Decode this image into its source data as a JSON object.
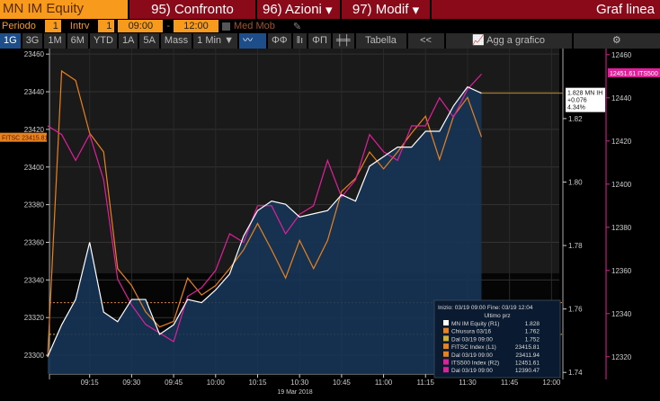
{
  "header": {
    "security": "MN IM Equity",
    "compare": "95) Confronto",
    "actions": "96) Azioni",
    "modify": "97) Modif",
    "chart_type": "Graf linea"
  },
  "params": {
    "period_label": "Periodo",
    "period_value": "1",
    "interval_label": "Intrv",
    "interval_value": "1",
    "start_time": "09:00",
    "dash": "-",
    "end_time": "12:00",
    "moving_avg": "Med Mob"
  },
  "toolbar": {
    "ranges": [
      "1G",
      "3G",
      "1M",
      "6M",
      "YTD",
      "1A",
      "5A",
      "Mass"
    ],
    "active": "1G",
    "interval": "1 Min ▼",
    "table": "Tabella",
    "collapse": "<<",
    "add": "Agg a grafico",
    "settings": "⚙"
  },
  "colors": {
    "mn": "#ffffff",
    "fitsc": "#e8821e",
    "its": "#e0209a",
    "chiusura": "#e8821e",
    "dal": "#d4b030",
    "accent": "#f89b1c"
  },
  "chart_data": {
    "type": "line",
    "date_label": "19 Mar 2018",
    "x_minutes_from_0900": [
      0,
      5,
      10,
      15,
      20,
      25,
      30,
      35,
      40,
      45,
      50,
      55,
      60,
      65,
      70,
      75,
      80,
      85,
      90,
      95,
      100,
      105,
      110,
      115,
      120,
      125,
      130,
      135,
      140,
      145,
      150,
      155
    ],
    "x_ticks": [
      "09:15",
      "09:30",
      "09:45",
      "10:00",
      "10:15",
      "10:30",
      "10:45",
      "11:00",
      "11:15",
      "11:30",
      "11:45",
      "12:00"
    ],
    "left_axis": {
      "ticks": [
        23300,
        23320,
        23340,
        23360,
        23380,
        23400,
        23420,
        23440,
        23460
      ],
      "range": [
        23290,
        23462
      ]
    },
    "mid_axis": {
      "ticks": [
        1.74,
        1.76,
        1.78,
        1.8,
        1.82
      ],
      "range": [
        1.7395,
        1.8415
      ]
    },
    "right_axis": {
      "ticks": [
        12320,
        12340,
        12360,
        12380,
        12400,
        12420,
        12440,
        12460
      ],
      "range": [
        12312,
        12462
      ]
    },
    "series": [
      {
        "name": "MN IM Equity (R1)",
        "axis": "mid",
        "values": [
          1.745,
          1.755,
          1.763,
          1.781,
          1.759,
          1.756,
          1.763,
          1.763,
          1.752,
          1.755,
          1.763,
          1.762,
          1.766,
          1.771,
          1.783,
          1.791,
          1.794,
          1.793,
          1.789,
          1.79,
          1.791,
          1.796,
          1.794,
          1.805,
          1.808,
          1.811,
          1.811,
          1.816,
          1.816,
          1.824,
          1.83,
          1.828
        ]
      },
      {
        "name": "FITSC Index (L1)",
        "axis": "left",
        "values": [
          23299,
          23451,
          23446,
          23418,
          23408,
          23346,
          23337,
          23323,
          23315,
          23318,
          23341,
          23332,
          23337,
          23346,
          23356,
          23370,
          23356,
          23341,
          23361,
          23346,
          23361,
          23387,
          23394,
          23408,
          23399,
          23408,
          23418,
          23427,
          23404,
          23427,
          23437,
          23416
        ]
      },
      {
        "name": "ITS500 Index (R2)",
        "axis": "right",
        "values": [
          12427,
          12423,
          12411,
          12423,
          12402,
          12356,
          12344,
          12335,
          12331,
          12327,
          12348,
          12352,
          12360,
          12377,
          12373,
          12390,
          12390,
          12377,
          12386,
          12390,
          12411,
          12394,
          12402,
          12423,
          12415,
          12411,
          12427,
          12427,
          12440,
          12431,
          12444,
          12451
        ]
      }
    ],
    "ref_lines": [
      {
        "name": "Chiusura 03/16",
        "axis": "mid",
        "value": 1.762
      },
      {
        "name": "Dal 03/19 09:00",
        "axis": "mid",
        "value": 1.752
      }
    ],
    "labels": {
      "fitsc_tag": "FITSC 23415.81",
      "its_tag": "12451.61 ITS500",
      "mn_tag": [
        "1.828 MN IH",
        "+0.076",
        "4.34%"
      ]
    },
    "legend": {
      "header": "Inizio: 03/19 09:00 Fine: 03/19 12:04",
      "sub": "Ultimo prz",
      "rows": [
        [
          "MN IM Equity  (R1)",
          "1.828"
        ],
        [
          "Chiusura 03/16",
          "1.762"
        ],
        [
          "Dal 03/19 09:00",
          "1.752"
        ],
        [
          "FITSC Index  (L1)",
          "23415.81"
        ],
        [
          "Dal 03/19 09:00",
          "23411.94"
        ],
        [
          "ITS500 Index  (R2)",
          "12451.61"
        ],
        [
          "Dal 03/19 09:00",
          "12390.47"
        ]
      ],
      "swatches": [
        "#ffffff",
        "#e8821e",
        "#d4b030",
        "#e8821e",
        "#e8821e",
        "#e0209a",
        "#e0209a"
      ]
    }
  }
}
